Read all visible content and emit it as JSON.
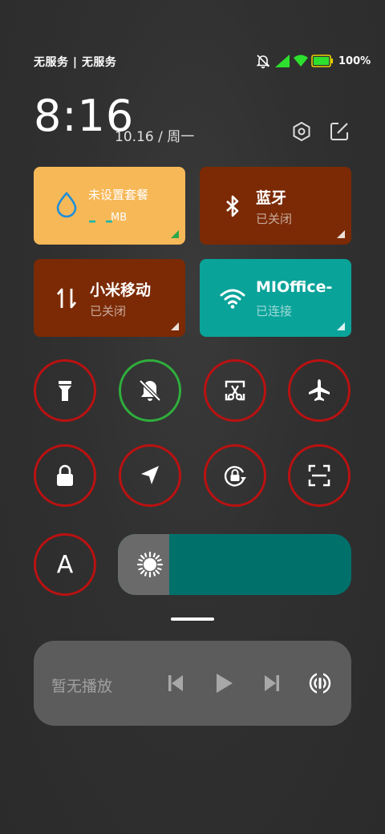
{
  "status_bar": {
    "carrier": "无服务 | 无服务",
    "battery_percent": "100%",
    "battery_level": 1.0,
    "icons": [
      "mute-icon",
      "signal-icon",
      "wifi-icon",
      "battery-icon"
    ],
    "accent_signal": "#2ee02e",
    "battery_color": "#e8d200"
  },
  "header": {
    "time": "8:16",
    "date": "10.16 / 周一",
    "icons": [
      "settings-icon",
      "edit-icon"
    ]
  },
  "tiles": {
    "data": {
      "title": "未设置套餐",
      "value": "– –",
      "unit": "MB",
      "icon": "water-drop-icon",
      "color": "#f7b858"
    },
    "bluetooth": {
      "title": "蓝牙",
      "sub": "已关闭",
      "icon": "bluetooth-icon",
      "color": "#7b2a05"
    },
    "mobile": {
      "title": "小米移动",
      "sub": "已关闭",
      "icon": "data-arrows-icon",
      "color": "#7b2a05"
    },
    "wifi": {
      "title": "MIOffice-",
      "sub": "已连接",
      "icon": "wifi-icon",
      "color": "#0aa39a"
    }
  },
  "toggles": [
    {
      "name": "flashlight",
      "icon": "flashlight-icon",
      "state": "off"
    },
    {
      "name": "mute",
      "icon": "bell-off-icon",
      "state": "on"
    },
    {
      "name": "screenshot",
      "icon": "scissors-icon",
      "state": "off"
    },
    {
      "name": "airplane",
      "icon": "airplane-icon",
      "state": "off"
    },
    {
      "name": "lock",
      "icon": "lock-icon",
      "state": "off"
    },
    {
      "name": "location",
      "icon": "location-arrow-icon",
      "state": "off"
    },
    {
      "name": "rotation-lock",
      "icon": "rotation-lock-icon",
      "state": "off"
    },
    {
      "name": "scanner",
      "icon": "scan-icon",
      "state": "off"
    },
    {
      "name": "auto-brightness",
      "label": "A",
      "icon": "auto-brightness-icon",
      "state": "off"
    }
  ],
  "brightness": {
    "level": 0.22,
    "icon": "sun-icon",
    "track_color": "#00706b"
  },
  "media": {
    "title": "暂无播放",
    "controls": [
      "previous-icon",
      "play-icon",
      "next-icon",
      "cast-icon"
    ]
  },
  "colors": {
    "toggle_off_ring": "#bb1111",
    "toggle_on_ring": "#2fae3c"
  }
}
